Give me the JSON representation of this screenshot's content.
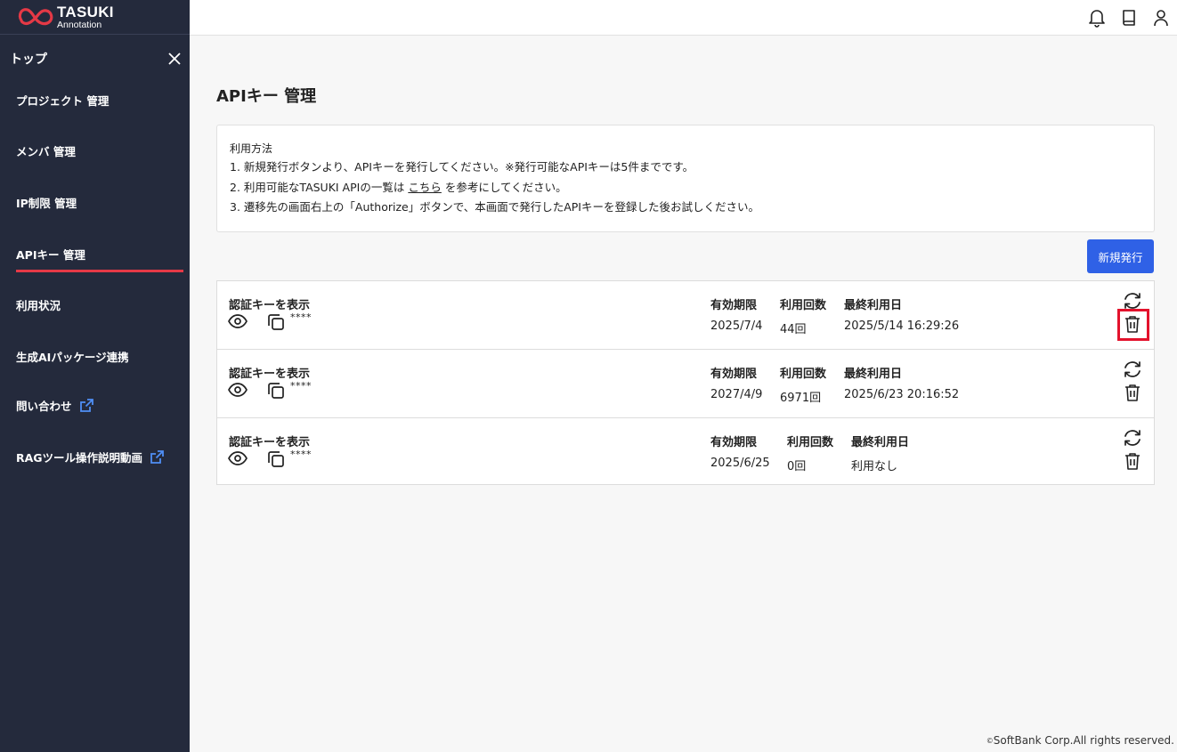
{
  "app": {
    "logo_line1": "TASUKI",
    "logo_line2": "Annotation",
    "brand_color": "#e53946"
  },
  "sidebar": {
    "title": "トップ",
    "items": [
      {
        "label": "プロジェクト 管理"
      },
      {
        "label": "メンバ 管理"
      },
      {
        "label": "IP制限 管理"
      },
      {
        "label": "APIキー 管理",
        "active": true
      },
      {
        "label": "利用状況"
      },
      {
        "label": "生成AIパッケージ連携"
      },
      {
        "label": "問い合わせ",
        "icon": "external-link-icon"
      },
      {
        "label": "RAGツール操作説明動画",
        "icon": "external-link-icon"
      }
    ]
  },
  "topbar": {
    "icons": [
      "bell-icon",
      "book-icon",
      "user-icon"
    ]
  },
  "main": {
    "title": "APIキー 管理",
    "usage": {
      "heading": "利用方法",
      "line1": "1. 新規発行ボタンより、APIキーを発行してください。※発行可能なAPIキーは5件までです。",
      "line2_pre": "2. 利用可能なTASUKI APIの一覧は",
      "line2_link": "こちら",
      "line2_post": "を参考にしてください。",
      "line3": "3. 遷移先の画面右上の「Authorize」ボタンで、本画面で発行したAPIキーを登録した後お試しください。"
    },
    "new_button": "新規発行",
    "column_headers": {
      "expiry": "有効期限",
      "count": "利用回数",
      "last_used": "最終利用日"
    },
    "keys": [
      {
        "label": "認証キーを表示",
        "masked": "****",
        "expiry": "2025/7/4",
        "count": "44回",
        "last_used": "2025/5/14 16:29:26"
      },
      {
        "label": "認証キーを表示",
        "masked": "****",
        "expiry": "2027/4/9",
        "count": "6971回",
        "last_used": "2025/6/23 20:16:52"
      },
      {
        "label": "認証キーを表示",
        "masked": "****",
        "expiry": "2025/6/25",
        "count": "0回",
        "last_used": "利用なし"
      }
    ]
  },
  "footer": {
    "copyright_mark": "©",
    "text": "SoftBank Corp.All rights reserved."
  }
}
